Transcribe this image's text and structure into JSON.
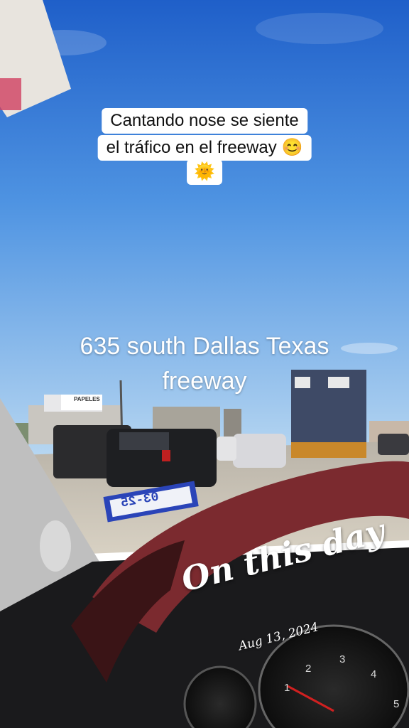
{
  "caption": {
    "line1": "Cantando nose se siente",
    "line2": "el tráfico en el freeway 😊",
    "line3": "🌞"
  },
  "location_text": {
    "line1": "635 south Dallas Texas",
    "line2": "freeway"
  },
  "sticker": {
    "title": "On this day",
    "date": "Aug 13, 2024"
  },
  "scene_labels": {
    "billboard": "PAPELES",
    "sticker_tag": "03-25"
  },
  "colors": {
    "sky_top": "#2f6fd0",
    "sky_bottom": "#a9cdee",
    "steering_wheel": "#7a2a2e"
  }
}
